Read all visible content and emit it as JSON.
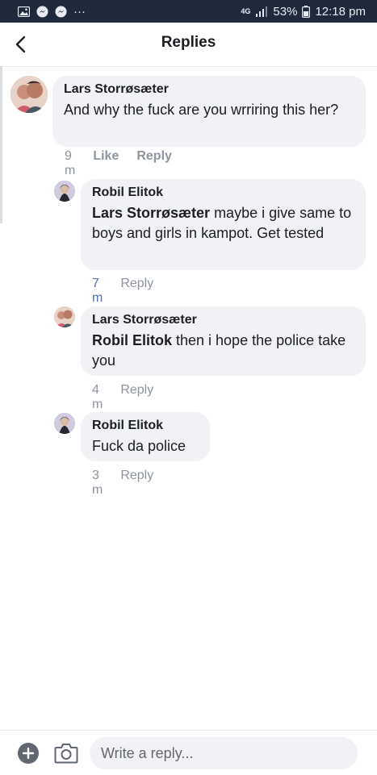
{
  "status_bar": {
    "network": "4G",
    "battery": "53%",
    "time": "12:18 pm",
    "more": "···",
    "icons": [
      "image-icon",
      "messenger-icon",
      "messenger-icon",
      "signal-icon",
      "battery-icon"
    ]
  },
  "header": {
    "title": "Replies",
    "back_icon": "chevron-left-icon"
  },
  "comments": [
    {
      "author": "Lars Storrøsæter",
      "mention": "",
      "text": "And why the fuck are you wrriring this her?",
      "time": "9 m",
      "like_label": "Like",
      "reply_label": "Reply"
    },
    {
      "author": "Robil Elitok",
      "mention": "Lars Storrøsæter",
      "text": " maybe i give same to boys and girls in kampot. Get tested",
      "time": "7 m",
      "reply_label": "Reply"
    },
    {
      "author": "Lars Storrøsæter",
      "mention": "Robil Elitok",
      "text": " then i hope the police take you",
      "time": "4 m",
      "reply_label": "Reply"
    },
    {
      "author": "Robil Elitok",
      "mention": "",
      "text": "Fuck da police",
      "time": "3 m",
      "reply_label": "Reply"
    }
  ],
  "composer": {
    "placeholder": "Write a reply...",
    "add_icon": "plus-circle-icon",
    "camera_icon": "camera-icon"
  },
  "colors": {
    "status_bar_bg": "#1e2a3c",
    "bubble_bg": "#f0f2f5",
    "link_blue": "#4f72bb",
    "meta_gray": "#8d949e"
  }
}
